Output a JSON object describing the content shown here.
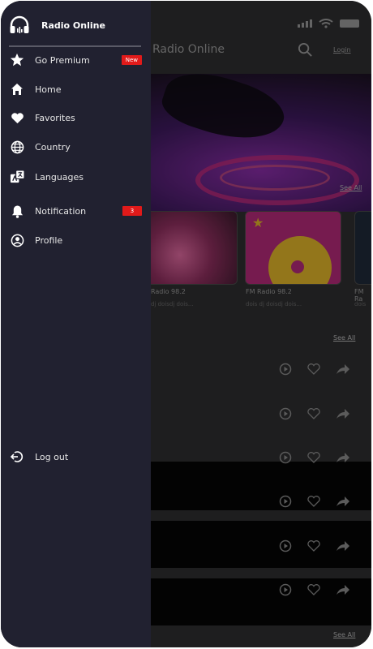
{
  "drawer": {
    "title": "Radio Online",
    "items": [
      {
        "label": "Go Premium",
        "icon": "star-icon",
        "badge": "New"
      },
      {
        "label": "Home",
        "icon": "home-icon"
      },
      {
        "label": "Favorites",
        "icon": "heart-icon"
      },
      {
        "label": "Country",
        "icon": "globe-icon"
      },
      {
        "label": "Languages",
        "icon": "translate-icon"
      },
      {
        "label": "Notification",
        "icon": "bell-icon",
        "badge": "3"
      },
      {
        "label": "Profile",
        "icon": "profile-icon"
      }
    ],
    "logout": {
      "label": "Log out",
      "icon": "logout-icon"
    }
  },
  "app": {
    "title": "Radio Online",
    "login": "Login",
    "see_all_1": "See All",
    "see_all_2": "See All",
    "see_all_3": "See All",
    "cards": [
      {
        "title": "Radio 98.2",
        "subtitle": "dj doisdj dois..."
      },
      {
        "title": "FM Radio 98.2",
        "subtitle": "dois dj doisdj dois..."
      },
      {
        "title": "FM Ra",
        "subtitle": "dois"
      }
    ]
  },
  "colors": {
    "drawer_bg": "#212130",
    "badge": "#e11a1a",
    "accent": "#b52a7a"
  }
}
